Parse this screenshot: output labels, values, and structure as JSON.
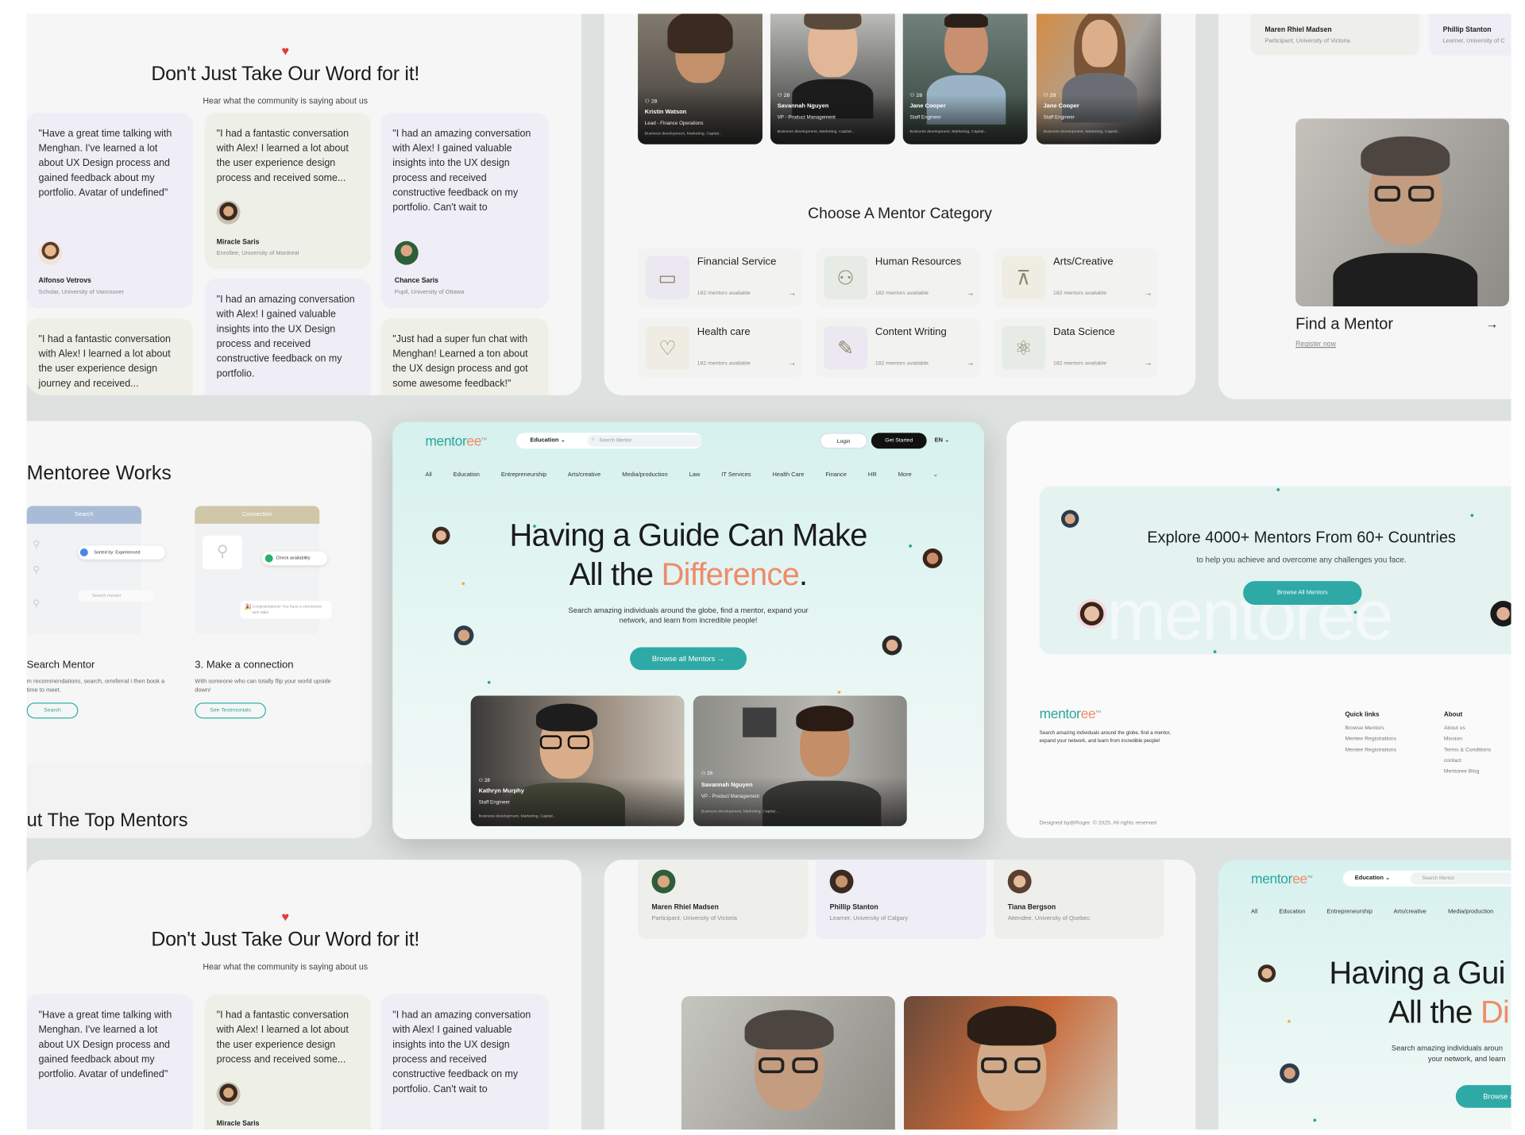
{
  "testimonials": {
    "heading": "Don't Just Take Our Word for it!",
    "subheading": "Hear what the community is saying about us",
    "cards": [
      {
        "quote": "\"Have a great time talking with Menghan. I've learned a lot about UX Design process and gained feedback about my portfolio. Avatar of undefined\"",
        "name": "Alfonso Vetrovs",
        "role": "Scholar, University of Vancouver"
      },
      {
        "quote": "\"I had a fantastic conversation with Alex! I learned a lot about the user experience design process and received some...",
        "name": "Miracle Saris",
        "role": "Enrollee, University of Montreal"
      },
      {
        "quote": "\"I had an amazing conversation with Alex! I gained valuable insights into the UX design process and received constructive feedback on my portfolio. Can't wait to",
        "name": "Chance Saris",
        "role": "Pupil, University of Ottawa"
      },
      {
        "quote": "\"I had a fantastic conversation with Alex! I learned a lot about the user experience design journey and received..."
      },
      {
        "quote": "\"I had an amazing conversation with Alex! I gained valuable insights into the UX Design process and received constructive feedback on my portfolio."
      },
      {
        "quote": "\"Just had a super fun chat with Menghan! Learned a ton about the UX design process and got some awesome feedback!\""
      }
    ]
  },
  "mentor_cards": [
    {
      "count": "28",
      "name": "Kristin Watson",
      "role": "Lead - Finance Operations",
      "tags": "Business development, Marketing, Capital..."
    },
    {
      "count": "28",
      "name": "Savannah Nguyen",
      "role": "VP - Product Management",
      "tags": "Business development, Marketing, Capital..."
    },
    {
      "count": "28",
      "name": "Jane Cooper",
      "role": "Staff Engineer",
      "tags": "Business development, Marketing, Capital..."
    },
    {
      "count": "28",
      "name": "Jane Cooper",
      "role": "Staff Engineer",
      "tags": "Business development, Marketing, Capital..."
    }
  ],
  "category": {
    "heading": "Choose A Mentor Category",
    "items": [
      {
        "icon": "credit-card-icon",
        "glyph": "▭",
        "title": "Financial Service",
        "count": "182 mentors available"
      },
      {
        "icon": "people-network-icon",
        "glyph": "⚇",
        "title": "Human Resources",
        "count": "182 mentors available"
      },
      {
        "icon": "easel-icon",
        "glyph": "⊼",
        "title": "Arts/Creative",
        "count": "182 mentors available"
      },
      {
        "icon": "hand-heart-icon",
        "glyph": "♡",
        "title": "Health care",
        "count": "182 mentors available"
      },
      {
        "icon": "document-edit-icon",
        "glyph": "✎",
        "title": "Content Writing",
        "count": "182 mentors available"
      },
      {
        "icon": "atom-icon",
        "glyph": "⚛",
        "title": "Data Science",
        "count": "182 mentors available"
      }
    ]
  },
  "top_right": {
    "people": [
      {
        "name": "Maren Rhiel Madsen",
        "role": "Participant, University of Victoria"
      },
      {
        "name": "Phillip Stanton",
        "role": "Learner, University of C"
      }
    ],
    "find_title": "Find a Mentor",
    "register": "Register now"
  },
  "how_it_works": {
    "heading": "Mentoree Works",
    "card1_tab": "Search",
    "sorted": "Sorted by: Experienced",
    "search_mentor_ph": "Search mentor",
    "card2_tab": "Connection",
    "check": "Check availability",
    "congrats": "Congratulations! You have a connection with Mike",
    "step2_title": "Search Mentor",
    "step2_text": "m recommendations, search, orreferral i then book a time to meet.",
    "step2_btn": "Search",
    "step3_title": "3. Make a connection",
    "step3_text": "With someone who can totally flip your world upside down!",
    "step3_btn": "See Testimonials",
    "bottom_heading": "ut The Top Mentors"
  },
  "hero": {
    "logo_a": "mentor",
    "logo_b": "ee",
    "logo_tm": "TM",
    "education": "Education",
    "search_ph": "Search Mentor",
    "login": "Login",
    "get_started": "Get Started",
    "lang": "EN",
    "nav": [
      "All",
      "Education",
      "Entrepreneurship",
      "Arts/creative",
      "Media/production",
      "Law",
      "IT Services",
      "Health Care",
      "Finance",
      "HR",
      "More"
    ],
    "title_line1": "Having a Guide Can Make",
    "title_line2a": "All the ",
    "title_line2b": "Difference",
    "title_line2c": ".",
    "desc": "Search amazing individuals around the globe, find a mentor, expand your network, and learn from incredible people!",
    "cta": "Browse all Mentors",
    "cards": [
      {
        "count": "28",
        "name": "Kathryn Murphy",
        "role": "Staff Engineer",
        "tags": "Business development, Marketing, Capital..."
      },
      {
        "count": "28",
        "name": "Savannah Nguyen",
        "role": "VP - Product Management",
        "tags": "Business development, Marketing, Capital..."
      }
    ]
  },
  "explore": {
    "title": "Explore 4000+ Mentors From 60+ Countries",
    "sub": "to help you achieve and overcome any challenges you face.",
    "btn": "Browse All Mentors",
    "watermark": "mentoree",
    "footer_desc": "Search amazing individuals around the globe, find a mentor, expand your network, and learn from incredible people!",
    "quick_title": "Quick links",
    "quick": [
      "Browse Mentors",
      "Mentee Registrations",
      "Mentee Registrations"
    ],
    "about_title": "About",
    "about": [
      "About us",
      "Mission",
      "Terms & Conditions",
      "contact",
      "Mentoree Blog"
    ],
    "credit": "Designed by@Roger. © 2025. All rights reserved"
  },
  "bottom_middle": {
    "people": [
      {
        "name": "Maren Rhiel Madsen",
        "role": "Participant, University of Victoria"
      },
      {
        "name": "Phillip Stanton",
        "role": "Learner, University of Calgary"
      },
      {
        "name": "Tiana Bergson",
        "role": "Attendee, University of Quebec"
      }
    ]
  },
  "bottom_right": {
    "education": "Education",
    "search_ph": "Search Mentor",
    "nav": [
      "All",
      "Education",
      "Entrepreneurship",
      "Arts/creative",
      "Media/production"
    ],
    "title_line1": "Having a Gui",
    "title_line2a": "All the ",
    "title_line2b": "Di",
    "desc1": "Search amazing individuals aroun",
    "desc2": "your network, and learn",
    "btn": "Browse all"
  },
  "colors": {
    "teal": "#2ea9a6",
    "coral": "#ef8b6a",
    "mint": "#d6f1ee"
  }
}
